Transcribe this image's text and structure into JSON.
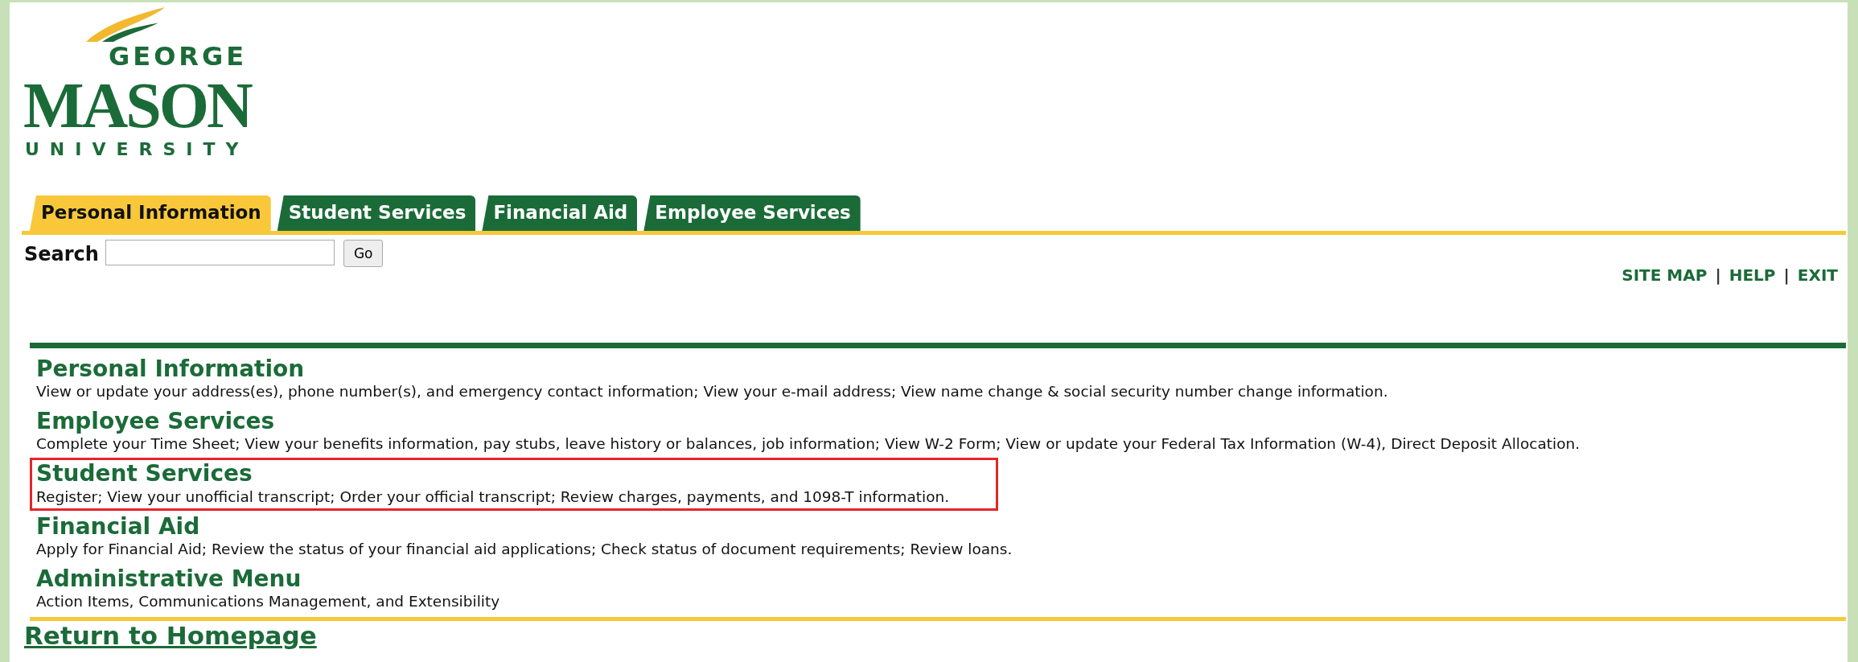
{
  "logo": {
    "line_1": "GEORGE",
    "line_2": "MASON",
    "line_3": "UNIVERSITY"
  },
  "tabs": [
    {
      "label": "Personal Information",
      "selected": true
    },
    {
      "label": "Student Services",
      "selected": false
    },
    {
      "label": "Financial Aid",
      "selected": false
    },
    {
      "label": "Employee Services",
      "selected": false
    }
  ],
  "search": {
    "label": "Search",
    "button": "Go"
  },
  "top_links": [
    "SITE MAP",
    "HELP",
    "EXIT"
  ],
  "link_separator": "|",
  "menu": [
    {
      "title": "Personal Information",
      "description": "View or update your address(es), phone number(s), and emergency contact information; View your e-mail address; View name change & social security number change information.",
      "highlighted": false
    },
    {
      "title": "Employee Services",
      "description": "Complete your Time Sheet; View your benefits information, pay stubs, leave history or balances, job information; View W-2 Form; View or update your Federal Tax Information (W-4), Direct Deposit Allocation.",
      "highlighted": false
    },
    {
      "title": "Student Services",
      "description": "Register; View your unofficial transcript; Order your official transcript; Review charges, payments, and 1098-T information.",
      "highlighted": true
    },
    {
      "title": "Financial Aid",
      "description": "Apply for Financial Aid; Review the status of your financial aid applications; Check status of document requirements; Review loans.",
      "highlighted": false
    },
    {
      "title": "Administrative Menu",
      "description": "Action Items, Communications Management, and Extensibility",
      "highlighted": false
    }
  ],
  "return_link": "Return to Homepage"
}
